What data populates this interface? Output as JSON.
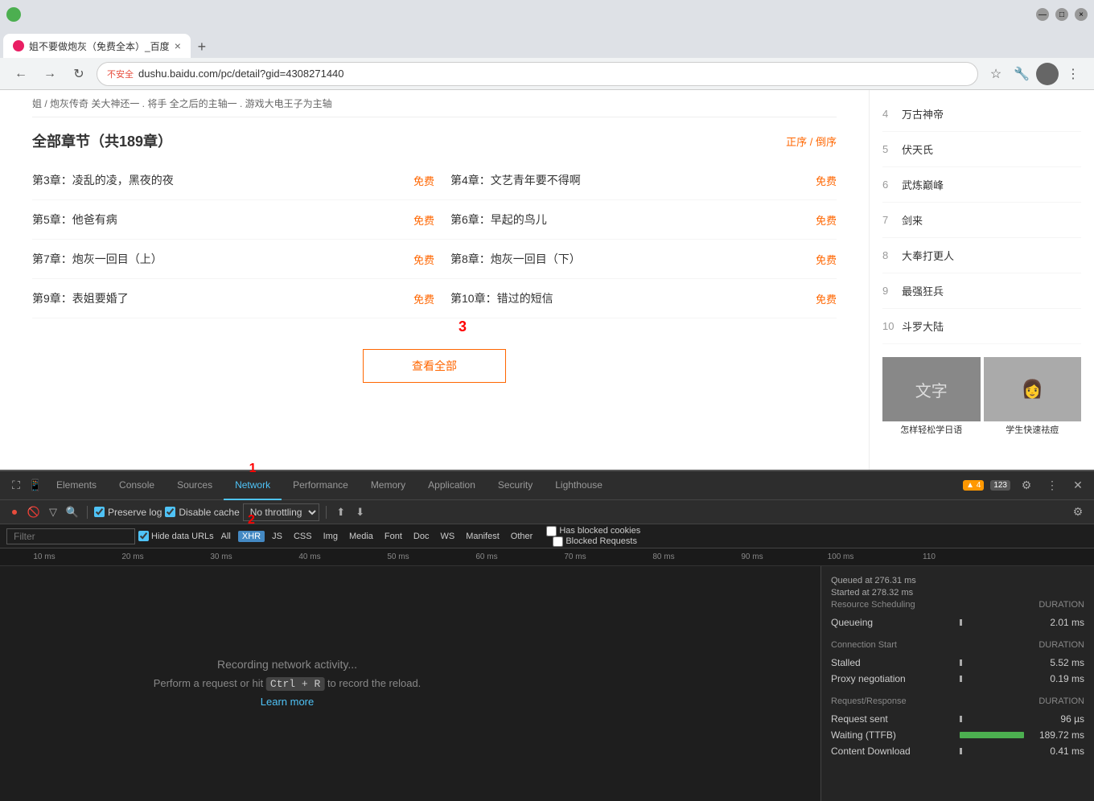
{
  "browser": {
    "tab_favicon_color": "#e91e63",
    "tab_title": "姐不要做炮灰（免费全本）_百度",
    "tab_close": "×",
    "new_tab": "+",
    "nav_back": "←",
    "nav_forward": "→",
    "nav_refresh": "↻",
    "url_secure_label": "不安全",
    "url": "dushu.baidu.com/pc/detail?gid=4308271440",
    "window_min": "—",
    "window_max": "□",
    "window_close": "×"
  },
  "page": {
    "top_text": "姐 / 炮灰传奇 关大神还一 . 将手 全之后的主轴一 . 游戏大电王子为主轴",
    "chapters_title": "全部章节（共189章）",
    "sort_label": "正序 / 倒序",
    "chapters": [
      {
        "name": "第3章：凌乱的凌，黑夜的夜",
        "free": "免费",
        "col": 0
      },
      {
        "name": "第4章：文艺青年要不得啊",
        "free": "免费",
        "col": 1
      },
      {
        "name": "第5章：他爸有病",
        "free": "免费",
        "col": 0
      },
      {
        "name": "第6章：早起的鸟儿",
        "free": "免费",
        "col": 1
      },
      {
        "name": "第7章：炮灰一回目（上）",
        "free": "免费",
        "col": 0
      },
      {
        "name": "第8章：炮灰一回目（下）",
        "free": "免费",
        "col": 1
      },
      {
        "name": "第9章：表姐要婚了",
        "free": "免费",
        "col": 0
      },
      {
        "name": "第10章：错过的短信",
        "free": "免费",
        "col": 1
      }
    ],
    "view_all_btn": "查看全部",
    "sidebar_items": [
      {
        "rank": "4",
        "title": "万古神帝"
      },
      {
        "rank": "5",
        "title": "伏天氏"
      },
      {
        "rank": "6",
        "title": "武炼巅峰"
      },
      {
        "rank": "7",
        "title": "剑来"
      },
      {
        "rank": "8",
        "title": "大奉打更人"
      },
      {
        "rank": "9",
        "title": "最强狂兵"
      },
      {
        "rank": "10",
        "title": "斗罗大陆"
      }
    ],
    "ad1_caption": "怎样轻松学日语",
    "ad2_caption": "学生快速祛痘"
  },
  "devtools": {
    "tabs": [
      "Elements",
      "Console",
      "Sources",
      "Network",
      "Performance",
      "Memory",
      "Application",
      "Security",
      "Lighthouse"
    ],
    "active_tab": "Network",
    "badge_warn": "▲ 4",
    "badge_log": "123",
    "toolbar": {
      "preserve_log_label": "Preserve log",
      "disable_cache_label": "Disable cache",
      "throttle_label": "No throttling",
      "throttle_arrow": "▼"
    },
    "filter": {
      "placeholder": "Filter",
      "hide_data_urls_label": "Hide data URLs",
      "all_label": "All",
      "xhr_label": "XHR",
      "js_label": "JS",
      "css_label": "CSS",
      "img_label": "Img",
      "media_label": "Media",
      "font_label": "Font",
      "doc_label": "Doc",
      "ws_label": "WS",
      "manifest_label": "Manifest",
      "other_label": "Other",
      "blocked_cookies_label": "Has blocked cookies",
      "blocked_requests_label": "Blocked Requests"
    },
    "timeline_labels": [
      "10 ms",
      "20 ms",
      "30 ms",
      "40 ms",
      "50 ms",
      "60 ms",
      "70 ms",
      "80 ms",
      "90 ms",
      "100 ms",
      "110"
    ],
    "recording_main": "Recording network activity...",
    "recording_sub1": "Perform a request or hit",
    "recording_shortcut": "Ctrl + R",
    "recording_sub2": "to record the reload.",
    "learn_more": "Learn more",
    "timing": {
      "queued_at": "Queued at 276.31 ms",
      "started_at": "Started at 278.32 ms",
      "resource_scheduling_label": "Resource Scheduling",
      "duration_label": "DURATION",
      "queueing_label": "Queueing",
      "queueing_value": "2.01 ms",
      "connection_start_label": "Connection Start",
      "stalled_label": "Stalled",
      "stalled_value": "5.52 ms",
      "proxy_label": "Proxy negotiation",
      "proxy_value": "0.19 ms",
      "request_response_label": "Request/Response",
      "request_sent_label": "Request sent",
      "request_sent_value": "96 µs",
      "waiting_label": "Waiting (TTFB)",
      "waiting_value": "189.72 ms",
      "content_dl_label": "Content Download",
      "content_dl_value": "0.41 ms"
    }
  },
  "annotations": {
    "ann1": "1",
    "ann2": "2",
    "ann3": "3"
  }
}
